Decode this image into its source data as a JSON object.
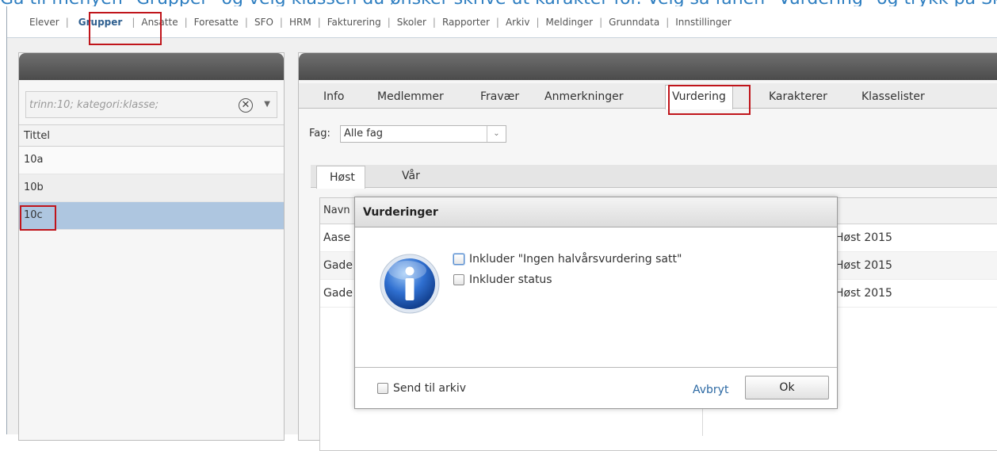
{
  "caption": "Gå til menyen \"Grupper\" og velg klassen du ønsker skrive ut karakter for. Velg så fanen \"Vurdering\" og trykk på Skriv ut i nedre høyre hjørne.",
  "topnav": {
    "items": [
      "Elever",
      "Grupper",
      "Ansatte",
      "Foresatte",
      "SFO",
      "HRM",
      "Fakturering",
      "Skoler",
      "Rapporter",
      "Arkiv",
      "Meldinger",
      "Grunndata",
      "Innstillinger"
    ],
    "active": "Grupper"
  },
  "left_panel": {
    "filter_placeholder": "trinn:10; kategori:klasse;",
    "column_title": "Tittel",
    "rows": [
      "10a",
      "10b",
      "10c"
    ],
    "selected": "10c"
  },
  "right_panel": {
    "tabs": [
      "Info",
      "Medlemmer",
      "Fravær",
      "Anmerkninger",
      "Vurdering",
      "Karakterer",
      "Klasselister"
    ],
    "active_tab": "Vurdering",
    "fag_label": "Fag:",
    "fag_value": "Alle fag",
    "subtabs": [
      "Høst",
      "Vår"
    ],
    "active_subtab": "Høst",
    "grid_header": "Navn",
    "grid_rows": [
      {
        "name": "Aase",
        "period": "Høst 2015"
      },
      {
        "name": "Gade",
        "period": "Høst 2015"
      },
      {
        "name": "Gade",
        "period": "Høst 2015"
      }
    ]
  },
  "modal": {
    "title": "Vurderinger",
    "option1": "Inkluder \"Ingen halvårsvurdering satt\"",
    "option2": "Inkluder status",
    "send_label": "Send til arkiv",
    "cancel_label": "Avbryt",
    "ok_label": "Ok"
  },
  "colors": {
    "highlight": "#c0151b",
    "selected_row": "#aec6e0",
    "link": "#2c69a3"
  }
}
